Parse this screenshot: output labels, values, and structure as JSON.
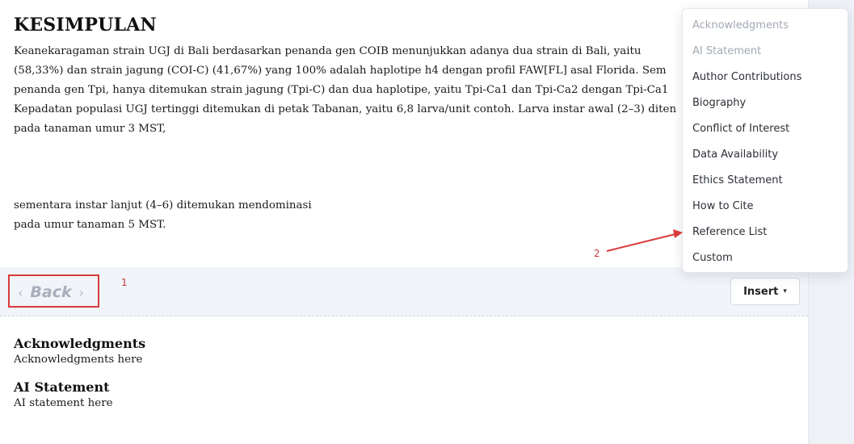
{
  "article": {
    "heading": "KESIMPULAN",
    "paragraph_lines": [
      "Keanekaragaman strain UGJ di Bali berdasarkan penanda gen COIB menunjukkan adanya dua strain di Bali, yaitu",
      "(58,33%) dan strain jagung (COI-C) (41,67%) yang 100% adalah haplotipe h4 dengan profil FAW[FL] asal Florida. Sem",
      "penanda gen Tpi, hanya ditemukan strain jagung (Tpi-C) dan dua haplotipe, yaitu Tpi-Ca1 dan Tpi-Ca2 dengan Tpi-Ca1",
      "Kepadatan populasi UGJ tertinggi ditemukan di petak Tabanan, yaitu 6,8 larva/unit contoh. Larva instar awal (2–3) diten",
      "pada tanaman umur 3 MST,"
    ],
    "paragraph2_lines": [
      "sementara instar lanjut (4–6) ditemukan mendominasi",
      "pada umur tanaman 5 MST."
    ]
  },
  "toolbar": {
    "back_label": "Back",
    "back_left_chevron": "‹",
    "back_right_chevron": "›",
    "insert_label": "Insert",
    "insert_caret": "▾"
  },
  "annotations": {
    "label_1": "1",
    "label_2": "2",
    "color": "#d93a3a"
  },
  "sections": [
    {
      "title": "Acknowledgments",
      "body": "Acknowledgments here"
    },
    {
      "title": "AI Statement",
      "body": "AI statement here"
    }
  ],
  "insert_menu": {
    "items": [
      {
        "label": "Acknowledgments",
        "disabled": true
      },
      {
        "label": "AI Statement",
        "disabled": true
      },
      {
        "label": "Author Contributions",
        "disabled": false
      },
      {
        "label": "Biography",
        "disabled": false
      },
      {
        "label": "Conflict of Interest",
        "disabled": false
      },
      {
        "label": "Data Availability",
        "disabled": false
      },
      {
        "label": "Ethics Statement",
        "disabled": false
      },
      {
        "label": "How to Cite",
        "disabled": false
      },
      {
        "label": "Reference List",
        "disabled": false
      },
      {
        "label": "Custom",
        "disabled": false
      }
    ]
  }
}
